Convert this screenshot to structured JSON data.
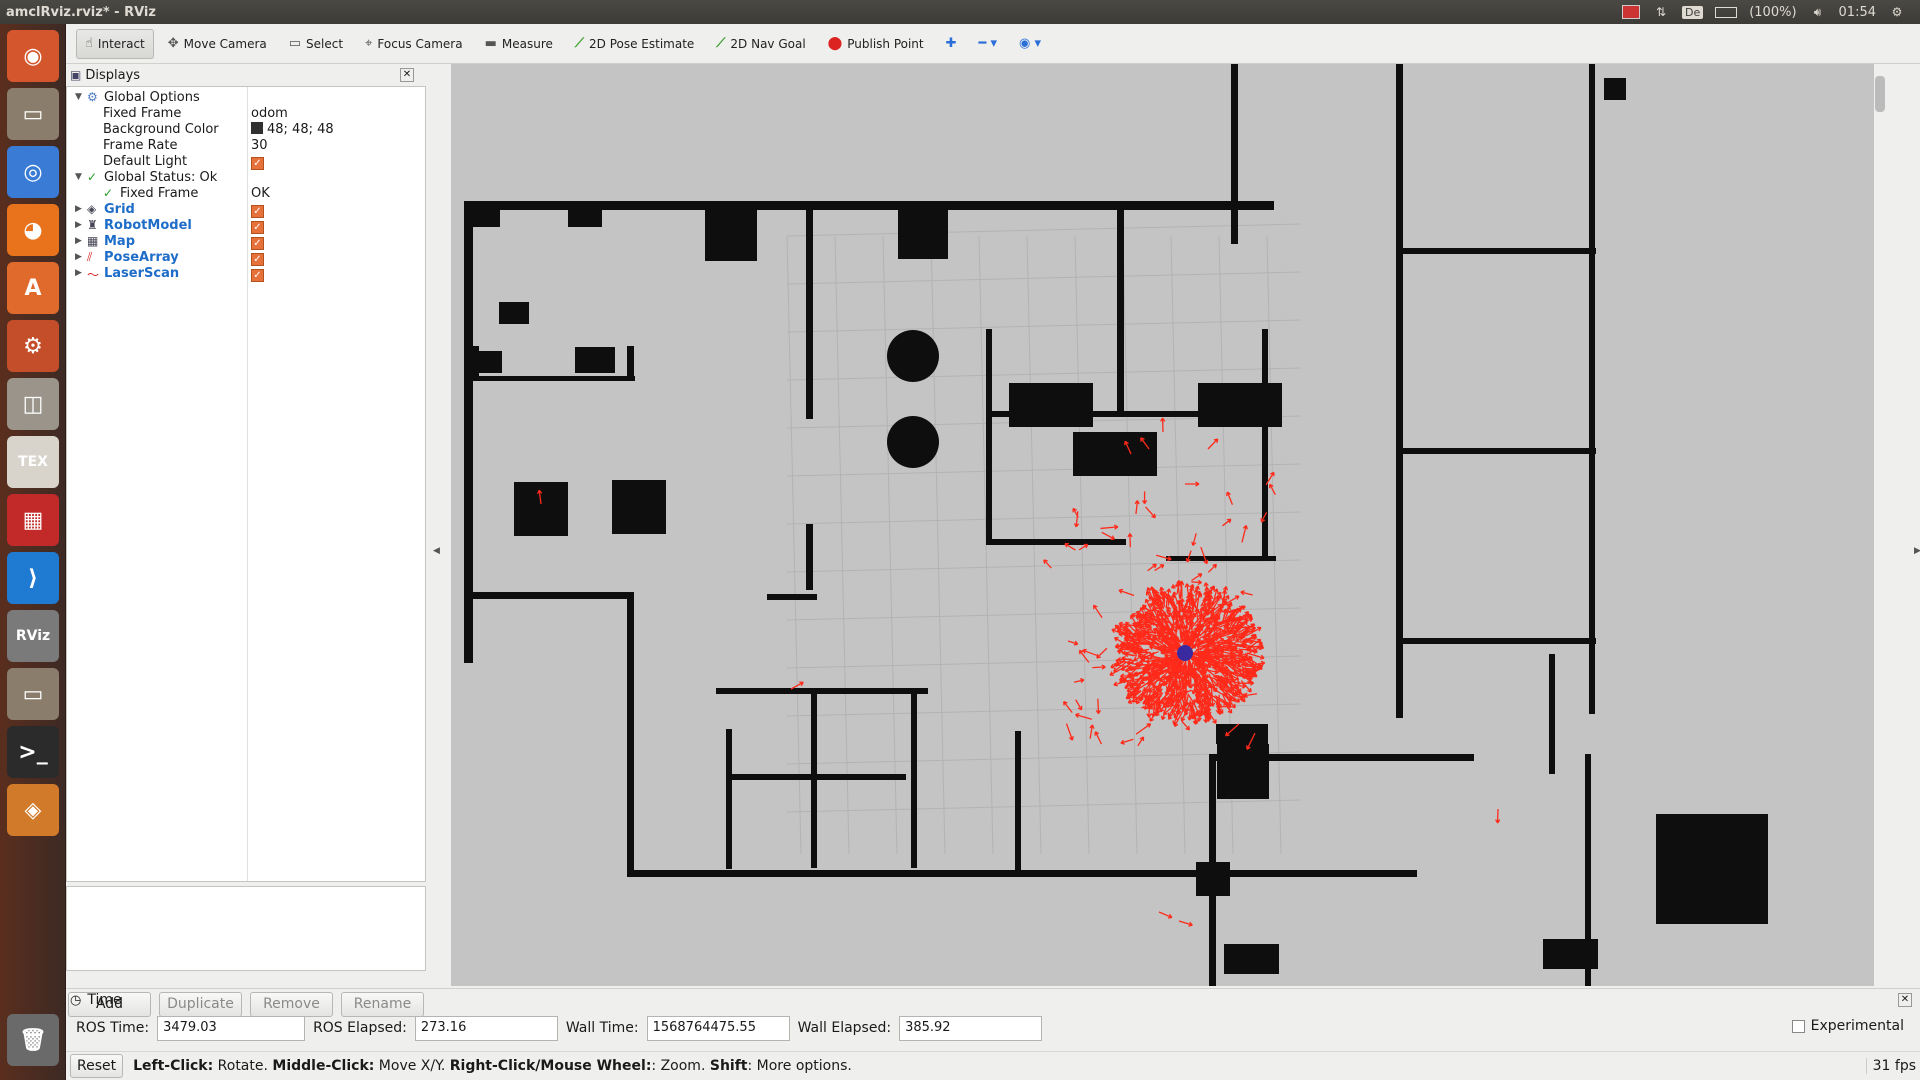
{
  "window_title": "amclRviz.rviz* - RViz",
  "system": {
    "keyboard": "De",
    "battery": "(100%)",
    "clock": "01:54"
  },
  "launcher": [
    {
      "name": "ubuntu-dash",
      "label": "◉",
      "color": "#d4562d"
    },
    {
      "name": "files",
      "label": "▭",
      "color": "#8b7d6b"
    },
    {
      "name": "chrome",
      "label": "◎",
      "color": "#3a7bd5"
    },
    {
      "name": "firefox",
      "label": "◕",
      "color": "#e8731c"
    },
    {
      "name": "software-center",
      "label": "A",
      "color": "#e06a2c"
    },
    {
      "name": "system-settings",
      "label": "⚙",
      "color": "#c44e2a"
    },
    {
      "name": "disks",
      "label": "◫",
      "color": "#9a948a"
    },
    {
      "name": "texmaker",
      "label": "TEX",
      "color": "#d8d4cc"
    },
    {
      "name": "calendar",
      "label": "▦",
      "color": "#c22a2a"
    },
    {
      "name": "vscode",
      "label": "⟩",
      "color": "#1f7ad1"
    },
    {
      "name": "rviz",
      "label": "RViz",
      "color": "#7a7a7a"
    },
    {
      "name": "files-2",
      "label": "▭",
      "color": "#8b7d6b"
    },
    {
      "name": "terminal",
      "label": ">_",
      "color": "#2b2b2b"
    },
    {
      "name": "virtualbox",
      "label": "◈",
      "color": "#d07a2a"
    },
    {
      "name": "trash",
      "label": "🗑",
      "color": "#6a6a6a"
    }
  ],
  "toolbar": [
    {
      "name": "interact",
      "label": "Interact",
      "icon": "☝",
      "cls": "",
      "active": true
    },
    {
      "name": "move-camera",
      "label": "Move Camera",
      "icon": "✥",
      "cls": "",
      "active": false
    },
    {
      "name": "select",
      "label": "Select",
      "icon": "▭",
      "cls": "",
      "active": false
    },
    {
      "name": "focus-camera",
      "label": "Focus Camera",
      "icon": "⌖",
      "cls": "",
      "active": false
    },
    {
      "name": "measure",
      "label": "Measure",
      "icon": "▬",
      "cls": "",
      "active": false
    },
    {
      "name": "2d-pose-estimate",
      "label": "2D Pose Estimate",
      "icon": "⟋",
      "cls": "green",
      "active": false
    },
    {
      "name": "2d-nav-goal",
      "label": "2D Nav Goal",
      "icon": "⟋",
      "cls": "green",
      "active": false
    },
    {
      "name": "publish-point",
      "label": "Publish Point",
      "icon": "⬤",
      "cls": "red",
      "active": false
    },
    {
      "name": "add-tool",
      "label": "",
      "icon": "✚",
      "cls": "blue",
      "active": false
    },
    {
      "name": "remove-tool",
      "label": "",
      "icon": "━ ▾",
      "cls": "blue",
      "active": false
    },
    {
      "name": "view-options",
      "label": "",
      "icon": "◉ ▾",
      "cls": "blue",
      "active": false
    }
  ],
  "displays": {
    "title": "Displays",
    "global_options": "Global Options",
    "fixed_frame_label": "Fixed Frame",
    "fixed_frame_value": "odom",
    "bg_color_label": "Background Color",
    "bg_color_value": "48; 48; 48",
    "frame_rate_label": "Frame Rate",
    "frame_rate_value": "30",
    "default_light_label": "Default Light",
    "global_status": "Global Status: Ok",
    "status_fixed_frame": "Fixed Frame",
    "status_fixed_frame_value": "OK",
    "items": [
      "Grid",
      "RobotModel",
      "Map",
      "PoseArray",
      "LaserScan"
    ],
    "buttons": [
      "Add",
      "Duplicate",
      "Remove",
      "Rename"
    ]
  },
  "time": {
    "title": "Time",
    "ros_time_label": "ROS Time:",
    "ros_time": "3479.03",
    "ros_elapsed_label": "ROS Elapsed:",
    "ros_elapsed": "273.16",
    "wall_time_label": "Wall Time:",
    "wall_time": "1568764475.55",
    "wall_elapsed_label": "Wall Elapsed:",
    "wall_elapsed": "385.92",
    "experimental": "Experimental"
  },
  "status": {
    "reset": "Reset",
    "k1": "Left-Click:",
    "v1": " Rotate. ",
    "k2": "Middle-Click:",
    "v2": " Move X/Y. ",
    "k3": "Right-Click/Mouse Wheel:",
    "v3": ": Zoom. ",
    "k4": "Shift",
    "v4": ": More options.",
    "fps": "31 fps"
  },
  "colors": {
    "map_bg": "#c4c4c4",
    "walls": "#0e0e0e",
    "particles": "#ff2a1a",
    "robot": "#3a2aa0"
  }
}
